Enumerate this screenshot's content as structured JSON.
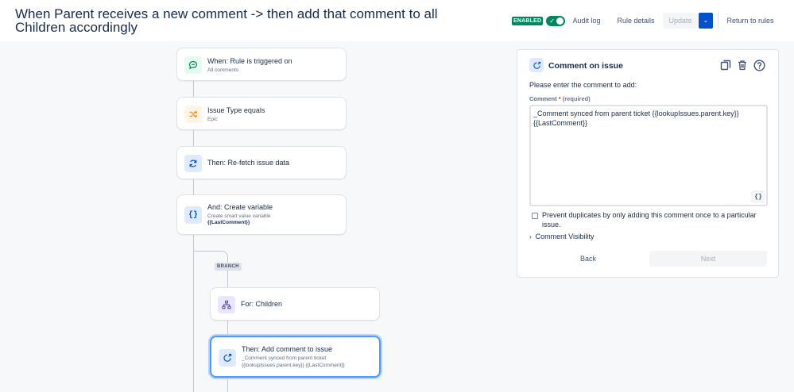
{
  "header": {
    "title": "When Parent receives a new comment -> then add that comment to all Children accordingly",
    "enabled_badge": "ENABLED",
    "audit_log": "Audit log",
    "rule_details": "Rule details",
    "update": "Update",
    "return_to_rules": "Return to rules"
  },
  "flow": {
    "trigger": {
      "title": "When: Rule is triggered on",
      "subtitle": "All comments",
      "icon": "comment-icon"
    },
    "condition": {
      "title": "Issue Type equals",
      "subtitle": "Epic",
      "icon": "shuffle-icon"
    },
    "refetch": {
      "title": "Then: Re-fetch issue data",
      "icon": "refresh-icon"
    },
    "variable": {
      "title": "And: Create variable",
      "subtitle": "Create smart value variable",
      "subtitle2": "{{LastComment}}",
      "icon": "braces-icon"
    },
    "branch_label": "BRANCH",
    "branch": {
      "title": "For: Children",
      "icon": "hierarchy-icon"
    },
    "action": {
      "title": "Then: Add comment to issue",
      "subtitle": "_Comment synced from parent ticket {{lookupIssues.parent.key}} {{LastComment}}",
      "icon": "comment-add-icon"
    }
  },
  "panel": {
    "title": "Comment on issue",
    "instruction": "Please enter the comment to add:",
    "field_label": "Comment",
    "required_mark": "*",
    "required_text": "(required)",
    "comment_value": "_Comment synced from parent ticket {{lookupIssues.parent.key}}\n{{LastComment}}",
    "smart_value_button": "{}",
    "prevent_duplicates": "Prevent duplicates by only adding this comment once to a particular issue.",
    "visibility": "Comment Visibility",
    "back": "Back",
    "next": "Next"
  },
  "colors": {
    "accent": "#0052cc",
    "enabled": "#00875a",
    "selected_border": "#4c9aff"
  }
}
